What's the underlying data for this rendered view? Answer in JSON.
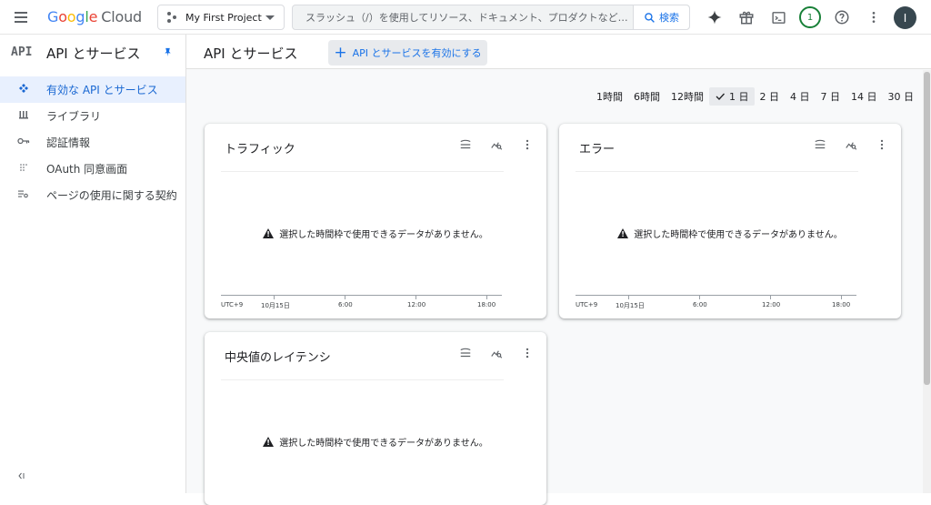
{
  "topbar": {
    "logo_google": [
      "G",
      "o",
      "o",
      "g",
      "l",
      "e"
    ],
    "logo_cloud": "Cloud",
    "project": "My First Project",
    "search_placeholder": "スラッシュ（/）を使用してリソース、ドキュメント、プロダクトなど…",
    "search_button": "検索",
    "notification_count": "1",
    "avatar_initial": "I"
  },
  "sidebar": {
    "api_logo": "API",
    "title": "API とサービス",
    "items": [
      {
        "label": "有効な API とサービス",
        "icon": "enabled-apis-icon",
        "active": true
      },
      {
        "label": "ライブラリ",
        "icon": "library-icon",
        "active": false
      },
      {
        "label": "認証情報",
        "icon": "key-icon",
        "active": false
      },
      {
        "label": "OAuth 同意画面",
        "icon": "oauth-icon",
        "active": false
      },
      {
        "label": "ページの使用に関する契約",
        "icon": "page-settings-icon",
        "active": false
      }
    ]
  },
  "main": {
    "title": "API とサービス",
    "enable_button": "API とサービスを有効にする",
    "time_ranges": [
      "1時間",
      "6時間",
      "12時間",
      "1 日",
      "2 日",
      "4 日",
      "7 日",
      "14 日",
      "30 日"
    ],
    "selected_range": "1 日",
    "cards": [
      {
        "title": "トラフィック",
        "empty": "選択した時間枠で使用できるデータがありません。",
        "axis": [
          "UTC+9",
          "10月15日",
          "6:00",
          "12:00",
          "18:00"
        ]
      },
      {
        "title": "エラー",
        "empty": "選択した時間枠で使用できるデータがありません。",
        "axis": [
          "UTC+9",
          "10月15日",
          "6:00",
          "12:00",
          "18:00"
        ]
      },
      {
        "title": "中央値のレイテンシ",
        "empty": "選択した時間枠で使用できるデータがありません。",
        "axis": []
      }
    ]
  },
  "colors": {
    "accent": "#1a73e8",
    "active_bg": "#e8f0fe",
    "notification": "#188038"
  }
}
